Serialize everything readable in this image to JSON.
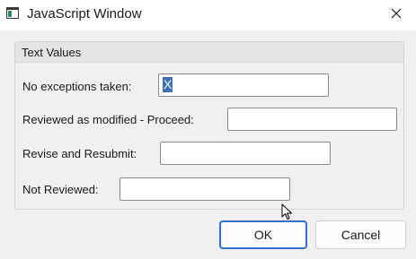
{
  "window": {
    "title": "JavaScript Window",
    "app_icon": "window-icon",
    "close_icon": "close-icon"
  },
  "group": {
    "title": "Text Values",
    "fields": [
      {
        "label": "No exceptions taken:",
        "value": "X",
        "selected": true
      },
      {
        "label": "Reviewed as modified - Proceed:",
        "value": ""
      },
      {
        "label": "Revise and Resubmit:",
        "value": ""
      },
      {
        "label": "Not Reviewed:",
        "value": ""
      }
    ]
  },
  "buttons": {
    "ok_label": "OK",
    "cancel_label": "Cancel"
  },
  "colors": {
    "accent": "#2f6fcf",
    "selection": "#3d6fb4"
  }
}
